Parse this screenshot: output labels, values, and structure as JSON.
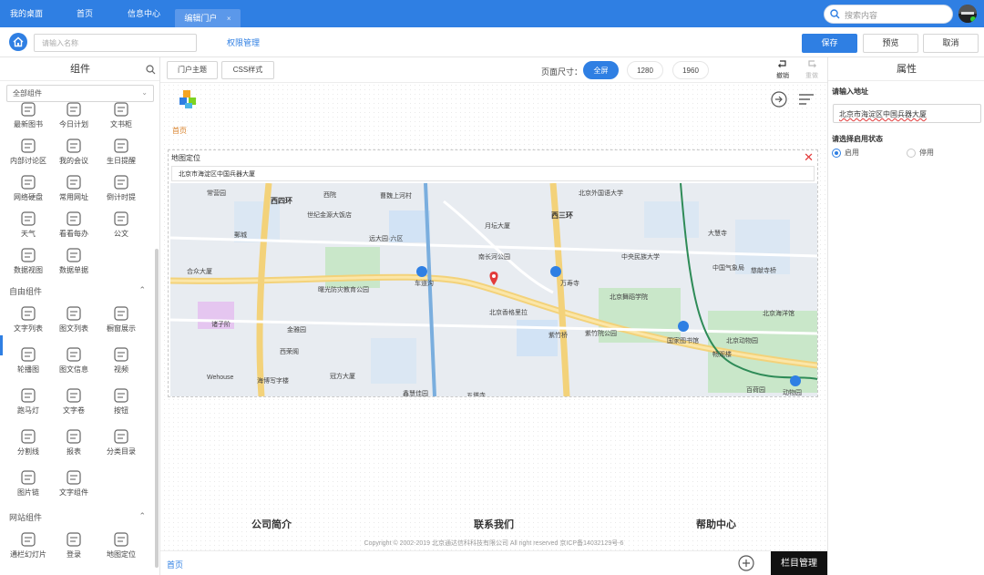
{
  "tabs": [
    {
      "label": "我的桌面"
    },
    {
      "label": "首页"
    },
    {
      "label": "信息中心"
    },
    {
      "label": "编辑门户",
      "close": "×"
    }
  ],
  "search": {
    "placeholder": "搜索内容"
  },
  "toolbar": {
    "name_placeholder": "请输入名称",
    "permission_link": "权限管理",
    "save": "保存",
    "preview": "预览",
    "cancel": "取消"
  },
  "left_panel": {
    "title": "组件",
    "category_select": "全部组件",
    "components_top": [
      {
        "label": "最新图书",
        "icon": "book-icon"
      },
      {
        "label": "今日计划",
        "icon": "plan-icon"
      },
      {
        "label": "文书柜",
        "icon": "cabinet-icon"
      },
      {
        "label": "内部讨论区",
        "icon": "chat-icon"
      },
      {
        "label": "我的会议",
        "icon": "meeting-icon"
      },
      {
        "label": "生日提醒",
        "icon": "cake-icon"
      },
      {
        "label": "网络硬盘",
        "icon": "disk-icon"
      },
      {
        "label": "常用网址",
        "icon": "star-icon"
      },
      {
        "label": "倒计时提",
        "icon": "hourglass-icon"
      },
      {
        "label": "天气",
        "icon": "weather-icon"
      },
      {
        "label": "看看每办",
        "icon": "todo-icon"
      },
      {
        "label": "公文",
        "icon": "document-icon"
      },
      {
        "label": "数据视图",
        "icon": "grid-icon"
      },
      {
        "label": "数据单据",
        "icon": "form-icon"
      }
    ],
    "free_section": "自由组件",
    "components_free": [
      {
        "label": "文字列表",
        "icon": "list-icon"
      },
      {
        "label": "图文列表",
        "icon": "image-list-icon"
      },
      {
        "label": "橱窗展示",
        "icon": "shop-icon"
      },
      {
        "label": "轮播图",
        "icon": "carousel-icon"
      },
      {
        "label": "图文信息",
        "icon": "image-text-icon"
      },
      {
        "label": "视频",
        "icon": "video-icon"
      },
      {
        "label": "跑马灯",
        "icon": "marquee-icon"
      },
      {
        "label": "文字卷",
        "icon": "text-scroll-icon"
      },
      {
        "label": "按钮",
        "icon": "button-icon"
      },
      {
        "label": "分割线",
        "icon": "divider-icon"
      },
      {
        "label": "报表",
        "icon": "chart-icon"
      },
      {
        "label": "分类目录",
        "icon": "catalog-icon"
      },
      {
        "label": "图片链",
        "icon": "picture-icon"
      },
      {
        "label": "文字组件",
        "icon": "text-icon"
      }
    ],
    "site_section": "网站组件",
    "components_site": [
      {
        "label": "通栏幻灯片",
        "icon": "slides-icon"
      },
      {
        "label": "登录",
        "icon": "login-icon"
      },
      {
        "label": "地图定位",
        "icon": "map-pin-icon"
      }
    ]
  },
  "center": {
    "portal_theme": "门户主题",
    "css_style": "CSS样式",
    "page_size_label": "页面尺寸：",
    "sizes": [
      "全屏",
      "1280",
      "1960"
    ],
    "active_size": "全屏",
    "undo": "撤销",
    "redo": "重做",
    "crumb": "首页",
    "map": {
      "title": "地图定位",
      "address": "北京市海淀区中国兵器大厦",
      "labels": [
        "西四环",
        "西三环",
        "常营园",
        "西院",
        "曹魏上河村",
        "北京外国语大学",
        "世纪金源大饭店",
        "远大园·六区",
        "月坛大厦",
        "郵城",
        "南长河公园",
        "中央民族大学",
        "大慧寺",
        "合众大厦",
        "车道沟",
        "万寿寺",
        "中国气象局",
        "慈献寺桥",
        "曙光防灾教育公园",
        "北京舞蹈学院",
        "紫竹院公园",
        "国家图书馆",
        "北京动物园",
        "诸子阶",
        "金雅园",
        "北京香格里拉",
        "紫竹桥",
        "畅观楼",
        "西荣阁",
        "Wehouse",
        "海博写字楼",
        "冠方大厦",
        "鑫慧佳园",
        "五塔寺",
        "百荷园",
        "动物园",
        "北京海洋馆"
      ]
    },
    "footer": {
      "links": [
        "公司简介",
        "联系我们",
        "帮助中心"
      ],
      "copyright": "Copyright © 2002-2019 北京通达信科科技有限公司 All right reserved 京ICP备14032129号-6"
    },
    "bottom_home": "首页",
    "column_manage": "栏目管理"
  },
  "right_panel": {
    "title": "属性",
    "address_label": "请输入地址",
    "address_value": "北京市海淀区中国兵器大厦",
    "status_label": "请选择启用状态",
    "status_options": [
      "启用",
      "停用"
    ],
    "status_selected": "启用"
  },
  "colors": {
    "accent": "#2f7fe3",
    "topbar": "#2f7fe3",
    "close": "#e23b3b",
    "crumb": "#d9822b"
  }
}
